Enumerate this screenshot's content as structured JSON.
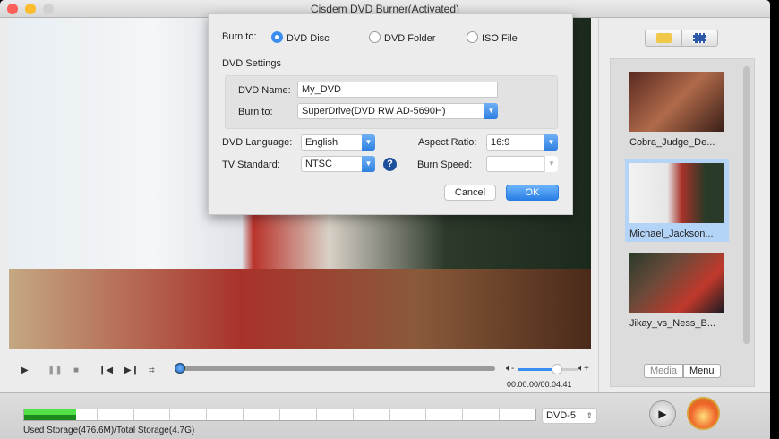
{
  "window": {
    "title": "Cisdem DVD Burner(Activated)"
  },
  "dialog": {
    "burn_to_label": "Burn to:",
    "options": [
      {
        "label": "DVD Disc",
        "selected": true
      },
      {
        "label": "DVD Folder",
        "selected": false
      },
      {
        "label": "ISO File",
        "selected": false
      }
    ],
    "settings_heading": "DVD Settings",
    "dvd_name_label": "DVD Name:",
    "dvd_name_value": "My_DVD",
    "drive_label": "Burn to:",
    "drive_value": "SuperDrive(DVD RW AD-5690H)",
    "language_label": "DVD Language:",
    "language_value": "English",
    "tv_label": "TV Standard:",
    "tv_value": "NTSC",
    "aspect_label": "Aspect Ratio:",
    "aspect_value": "16:9",
    "speed_label": "Burn Speed:",
    "speed_value": "",
    "help": "?",
    "cancel": "Cancel",
    "ok": "OK"
  },
  "player": {
    "time": "00:00:00/00:04:41",
    "progress_percent": 0,
    "volume_percent": 65
  },
  "media": {
    "items": [
      {
        "name": "Cobra_Judge_De...",
        "selected": false
      },
      {
        "name": "Michael_Jackson...",
        "selected": true
      },
      {
        "name": "Jikay_vs_Ness_B...",
        "selected": false
      }
    ],
    "tabs": [
      {
        "label": "Media",
        "active": false
      },
      {
        "label": "Menu",
        "active": true
      }
    ]
  },
  "storage": {
    "text": "Used Storage(476.6M)/Total Storage(4.7G)",
    "used_mb": 476.6,
    "total_gb": 4.7,
    "disc_type": "DVD-5"
  },
  "colors": {
    "accent": "#3b8ff2",
    "meter": "#52e048"
  }
}
